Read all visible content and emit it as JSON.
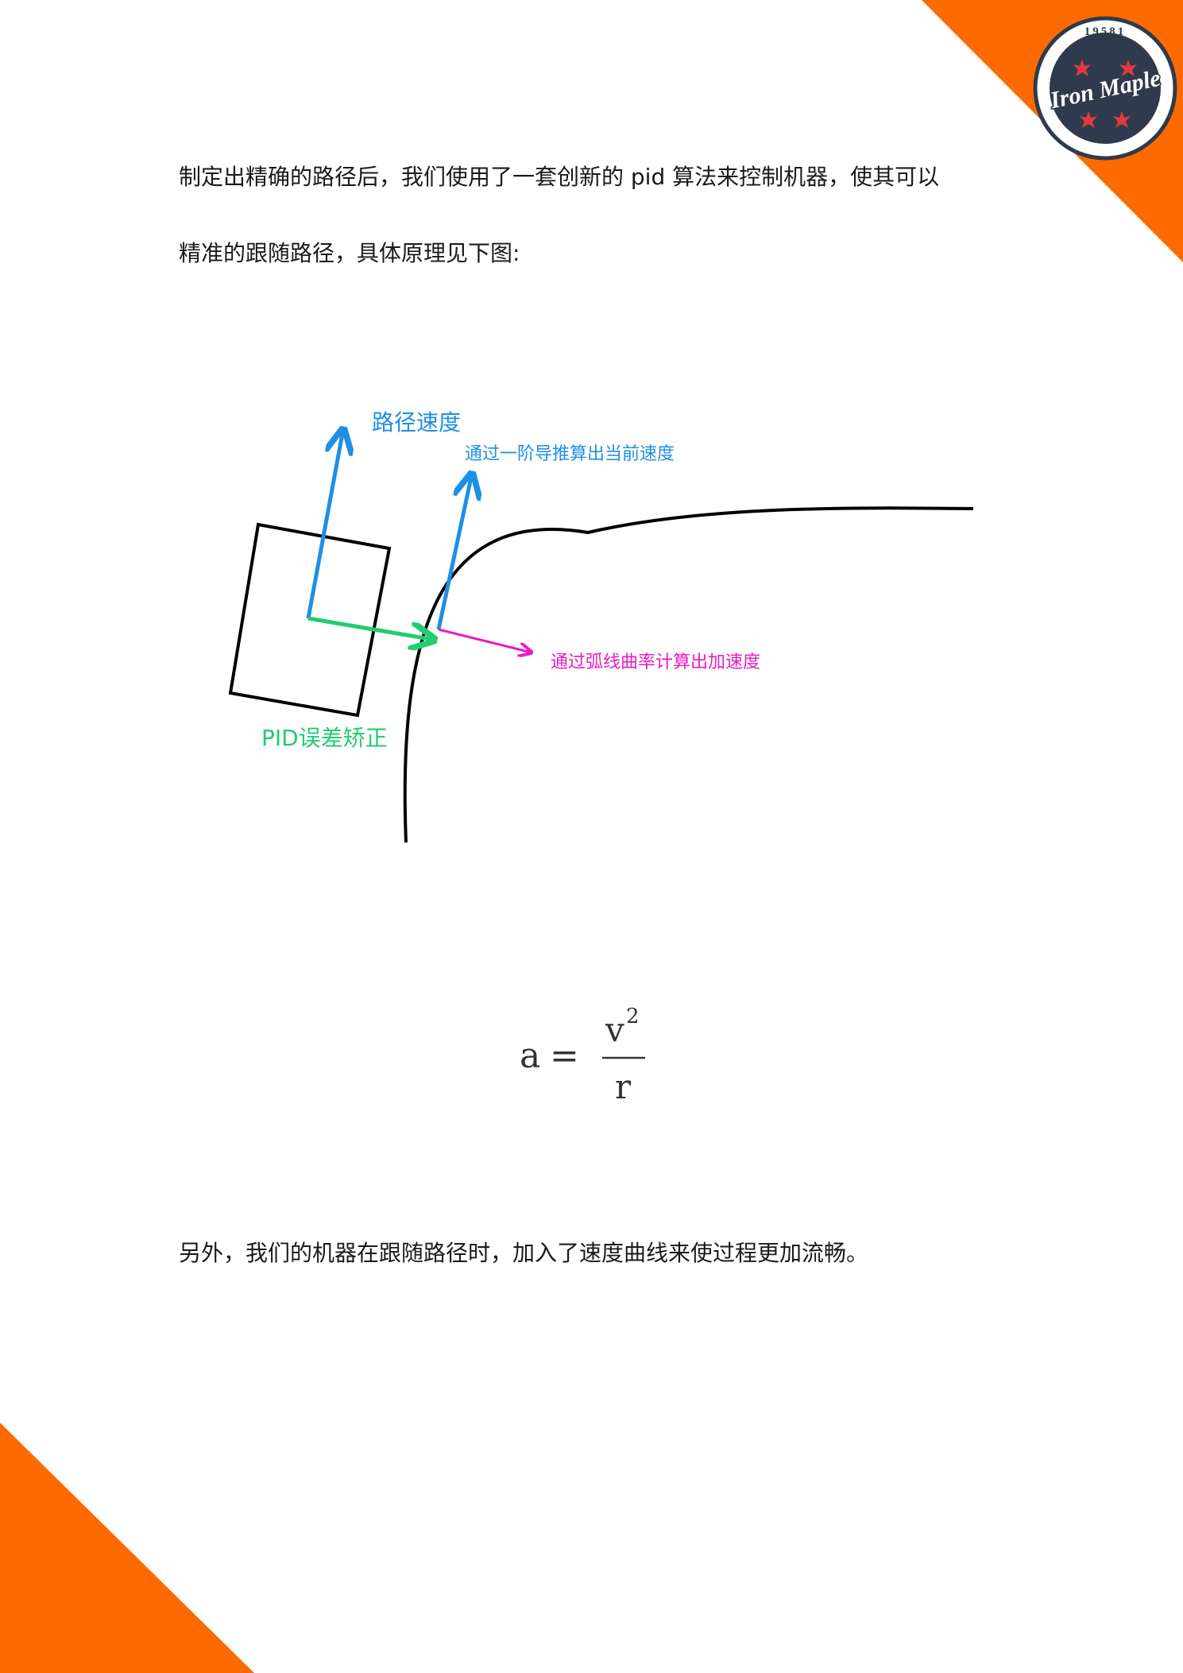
{
  "paragraphs": {
    "p1": "制定出精确的路径后，我们使用了一套创新的 pid 算法来控制机器，使其可以",
    "p2": "精准的跟随路径，具体原理见下图:",
    "p3": "另外，我们的机器在跟随路径时，加入了速度曲线来使过程更加流畅。"
  },
  "logo": {
    "team_number": "19581",
    "name": "Iron Maple"
  },
  "diagram": {
    "label_path_velocity": "路径速度",
    "label_derivative": "通过一阶导推算出当前速度",
    "label_curvature": "通过弧线曲率计算出加速度",
    "label_pid": "PID误差矫正"
  },
  "formula": {
    "lhs": "a",
    "equals": "=",
    "numerator": "v",
    "exponent": "2",
    "denominator": "r"
  },
  "colors": {
    "accent_orange": "#ff6a00",
    "velocity_blue": "#1e8fe6",
    "acceleration_magenta": "#ea1bc4",
    "pid_green": "#22cc70",
    "logo_navy": "#2f3a4e"
  }
}
